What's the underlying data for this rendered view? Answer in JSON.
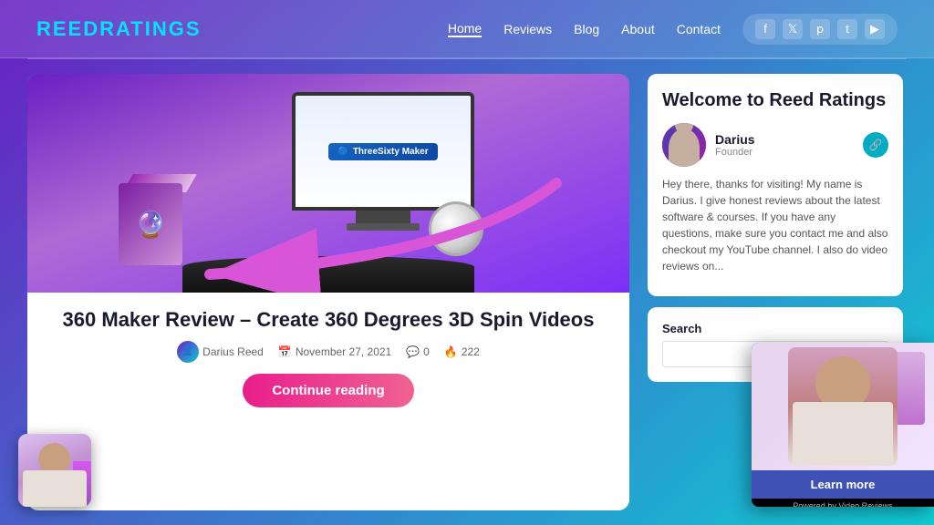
{
  "header": {
    "logo_text": "ReedRatings",
    "logo_part1": "Reed",
    "logo_part2": "Ratings",
    "nav": {
      "items": [
        {
          "label": "Home",
          "active": true
        },
        {
          "label": "Reviews",
          "active": false
        },
        {
          "label": "Blog",
          "active": false
        },
        {
          "label": "About",
          "active": false
        },
        {
          "label": "Contact",
          "active": false
        }
      ]
    },
    "social": [
      "f",
      "t",
      "p",
      "t",
      "yt"
    ]
  },
  "main_article": {
    "title": "360 Maker Review – Create 360 Degrees 3D Spin Videos",
    "author": "Darius Reed",
    "date": "November 27, 2021",
    "comments": "0",
    "views": "222",
    "continue_btn": "Continue reading",
    "image_alt": "ThreeSixty Maker product image"
  },
  "sidebar": {
    "welcome_title": "Welcome to Reed Ratings",
    "author_name": "Darius",
    "author_role": "Founder",
    "bio_text": "Hey there, thanks for visiting! My name is Darius. I give honest reviews about the latest software & courses. If you have any questions, make sure you contact me and also checkout my YouTube channel. I also do video reviews on...",
    "search_label": "Search",
    "search_placeholder": ""
  },
  "video_popup": {
    "learn_more_label": "Learn more",
    "powered_by": "Powered by Video Reviews"
  },
  "icons": {
    "calendar": "📅",
    "comment": "💬",
    "fire": "🔥",
    "link": "🔗"
  }
}
